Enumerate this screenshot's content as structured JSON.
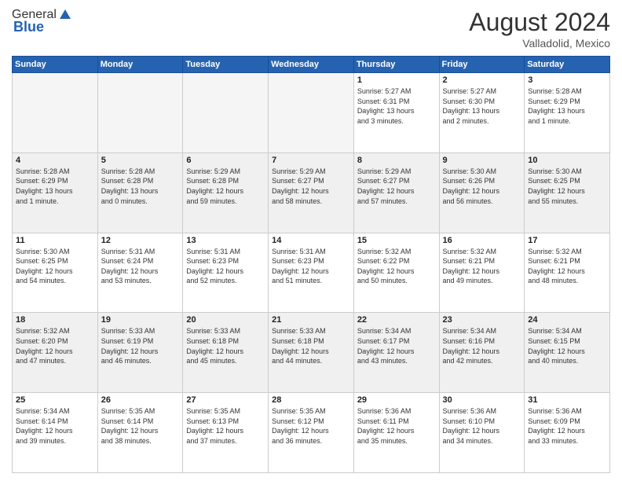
{
  "header": {
    "logo": {
      "general": "General",
      "blue": "Blue"
    },
    "title": "August 2024",
    "location": "Valladolid, Mexico"
  },
  "days_of_week": [
    "Sunday",
    "Monday",
    "Tuesday",
    "Wednesday",
    "Thursday",
    "Friday",
    "Saturday"
  ],
  "weeks": [
    [
      {
        "day": null,
        "info": null
      },
      {
        "day": null,
        "info": null
      },
      {
        "day": null,
        "info": null
      },
      {
        "day": null,
        "info": null
      },
      {
        "day": "1",
        "info": "Sunrise: 5:27 AM\nSunset: 6:31 PM\nDaylight: 13 hours\nand 3 minutes."
      },
      {
        "day": "2",
        "info": "Sunrise: 5:27 AM\nSunset: 6:30 PM\nDaylight: 13 hours\nand 2 minutes."
      },
      {
        "day": "3",
        "info": "Sunrise: 5:28 AM\nSunset: 6:29 PM\nDaylight: 13 hours\nand 1 minute."
      }
    ],
    [
      {
        "day": "4",
        "info": "Sunrise: 5:28 AM\nSunset: 6:29 PM\nDaylight: 13 hours\nand 1 minute."
      },
      {
        "day": "5",
        "info": "Sunrise: 5:28 AM\nSunset: 6:28 PM\nDaylight: 13 hours\nand 0 minutes."
      },
      {
        "day": "6",
        "info": "Sunrise: 5:29 AM\nSunset: 6:28 PM\nDaylight: 12 hours\nand 59 minutes."
      },
      {
        "day": "7",
        "info": "Sunrise: 5:29 AM\nSunset: 6:27 PM\nDaylight: 12 hours\nand 58 minutes."
      },
      {
        "day": "8",
        "info": "Sunrise: 5:29 AM\nSunset: 6:27 PM\nDaylight: 12 hours\nand 57 minutes."
      },
      {
        "day": "9",
        "info": "Sunrise: 5:30 AM\nSunset: 6:26 PM\nDaylight: 12 hours\nand 56 minutes."
      },
      {
        "day": "10",
        "info": "Sunrise: 5:30 AM\nSunset: 6:25 PM\nDaylight: 12 hours\nand 55 minutes."
      }
    ],
    [
      {
        "day": "11",
        "info": "Sunrise: 5:30 AM\nSunset: 6:25 PM\nDaylight: 12 hours\nand 54 minutes."
      },
      {
        "day": "12",
        "info": "Sunrise: 5:31 AM\nSunset: 6:24 PM\nDaylight: 12 hours\nand 53 minutes."
      },
      {
        "day": "13",
        "info": "Sunrise: 5:31 AM\nSunset: 6:23 PM\nDaylight: 12 hours\nand 52 minutes."
      },
      {
        "day": "14",
        "info": "Sunrise: 5:31 AM\nSunset: 6:23 PM\nDaylight: 12 hours\nand 51 minutes."
      },
      {
        "day": "15",
        "info": "Sunrise: 5:32 AM\nSunset: 6:22 PM\nDaylight: 12 hours\nand 50 minutes."
      },
      {
        "day": "16",
        "info": "Sunrise: 5:32 AM\nSunset: 6:21 PM\nDaylight: 12 hours\nand 49 minutes."
      },
      {
        "day": "17",
        "info": "Sunrise: 5:32 AM\nSunset: 6:21 PM\nDaylight: 12 hours\nand 48 minutes."
      }
    ],
    [
      {
        "day": "18",
        "info": "Sunrise: 5:32 AM\nSunset: 6:20 PM\nDaylight: 12 hours\nand 47 minutes."
      },
      {
        "day": "19",
        "info": "Sunrise: 5:33 AM\nSunset: 6:19 PM\nDaylight: 12 hours\nand 46 minutes."
      },
      {
        "day": "20",
        "info": "Sunrise: 5:33 AM\nSunset: 6:18 PM\nDaylight: 12 hours\nand 45 minutes."
      },
      {
        "day": "21",
        "info": "Sunrise: 5:33 AM\nSunset: 6:18 PM\nDaylight: 12 hours\nand 44 minutes."
      },
      {
        "day": "22",
        "info": "Sunrise: 5:34 AM\nSunset: 6:17 PM\nDaylight: 12 hours\nand 43 minutes."
      },
      {
        "day": "23",
        "info": "Sunrise: 5:34 AM\nSunset: 6:16 PM\nDaylight: 12 hours\nand 42 minutes."
      },
      {
        "day": "24",
        "info": "Sunrise: 5:34 AM\nSunset: 6:15 PM\nDaylight: 12 hours\nand 40 minutes."
      }
    ],
    [
      {
        "day": "25",
        "info": "Sunrise: 5:34 AM\nSunset: 6:14 PM\nDaylight: 12 hours\nand 39 minutes."
      },
      {
        "day": "26",
        "info": "Sunrise: 5:35 AM\nSunset: 6:14 PM\nDaylight: 12 hours\nand 38 minutes."
      },
      {
        "day": "27",
        "info": "Sunrise: 5:35 AM\nSunset: 6:13 PM\nDaylight: 12 hours\nand 37 minutes."
      },
      {
        "day": "28",
        "info": "Sunrise: 5:35 AM\nSunset: 6:12 PM\nDaylight: 12 hours\nand 36 minutes."
      },
      {
        "day": "29",
        "info": "Sunrise: 5:36 AM\nSunset: 6:11 PM\nDaylight: 12 hours\nand 35 minutes."
      },
      {
        "day": "30",
        "info": "Sunrise: 5:36 AM\nSunset: 6:10 PM\nDaylight: 12 hours\nand 34 minutes."
      },
      {
        "day": "31",
        "info": "Sunrise: 5:36 AM\nSunset: 6:09 PM\nDaylight: 12 hours\nand 33 minutes."
      }
    ]
  ]
}
